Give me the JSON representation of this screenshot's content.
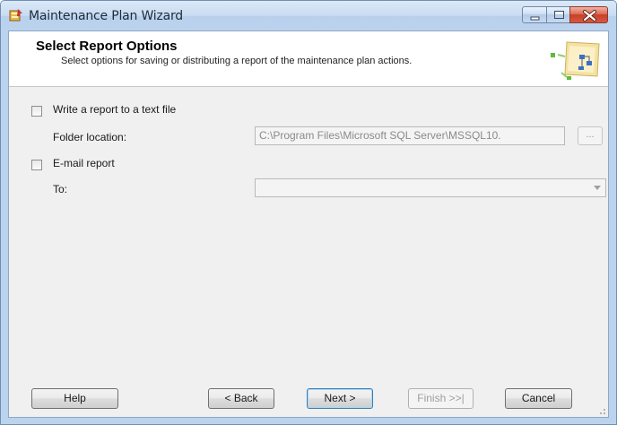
{
  "window": {
    "title": "Maintenance Plan Wizard"
  },
  "header": {
    "title": "Select Report Options",
    "description": "Select options for saving or distributing a report of the maintenance plan actions."
  },
  "options": {
    "write_report_label": "Write a report to a text file",
    "write_report_checked": false,
    "folder_location_label": "Folder location:",
    "folder_location_value": "C:\\Program Files\\Microsoft SQL Server\\MSSQL10.",
    "browse_label": "...",
    "email_report_label": "E-mail report",
    "email_report_checked": false,
    "to_label": "To:",
    "to_value": ""
  },
  "footer": {
    "help_label": "Help",
    "back_label": "< Back",
    "next_label": "Next >",
    "finish_label": "Finish >>|",
    "cancel_label": "Cancel"
  },
  "colors": {
    "titlebar": "#bcd3ee",
    "client_background": "#f0f0f0",
    "close_button": "#c7402a",
    "default_button_border": "#3c7fb1"
  }
}
